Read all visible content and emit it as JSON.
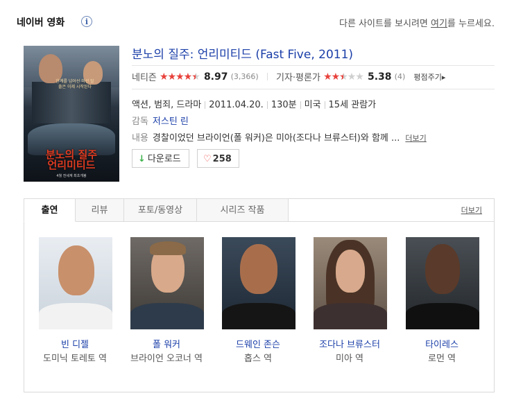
{
  "header": {
    "title": "네이버 영화",
    "info_icon": "info-icon",
    "right_text_pre": "다른 사이트를 보시려면 ",
    "right_link": "여기",
    "right_text_post": "를 누르세요."
  },
  "movie": {
    "title": "분노의 질주: 언리미티드 (Fast Five, 2011)",
    "netizen_label": "네티즌",
    "netizen_score": "8.97",
    "netizen_count": "(3,366)",
    "netizen_stars": 4.5,
    "critic_label": "기자·평론가",
    "critic_score": "5.38",
    "critic_count": "(4)",
    "critic_stars": 2.5,
    "rate_link": "평점주기▸",
    "genre": "액션, 범죄, 드라마",
    "release": "2011.04.20.",
    "runtime": "130분",
    "country": "미국",
    "age_rating": "15세 관람가",
    "director_label": "감독",
    "director": "저스틴 린",
    "plot_label": "내용",
    "plot": "경찰이었던 브라이언(폴 워커)은 미아(조다나 브류스터)와 함께 ...",
    "plot_more": "더보기",
    "download_label": "다운로드",
    "like_count": "258"
  },
  "poster": {
    "tagline": "한계를 넘어선 미션 탈출은 이제 시작된다",
    "title_line1": "분노의 질주",
    "title_line2": "언리미티드",
    "date": "4월 전세계 최초개봉"
  },
  "tabs": [
    {
      "label": "출연"
    },
    {
      "label": "리뷰"
    },
    {
      "label": "포토/동영상"
    },
    {
      "label": "시리즈 작품"
    }
  ],
  "more_link": "더보기",
  "cast": [
    {
      "name": "빈 디젤",
      "role": "도미닉 토레토 역"
    },
    {
      "name": "폴 워커",
      "role": "브라이언 오코너 역"
    },
    {
      "name": "드웨인 존슨",
      "role": "홉스 역"
    },
    {
      "name": "조다나 브류스터",
      "role": "미아 역"
    },
    {
      "name": "타이레스",
      "role": "로먼 역"
    }
  ],
  "colors": {
    "link_blue": "#1a3ea8",
    "star_red": "#e8413b",
    "download_green": "#3bb24a"
  }
}
